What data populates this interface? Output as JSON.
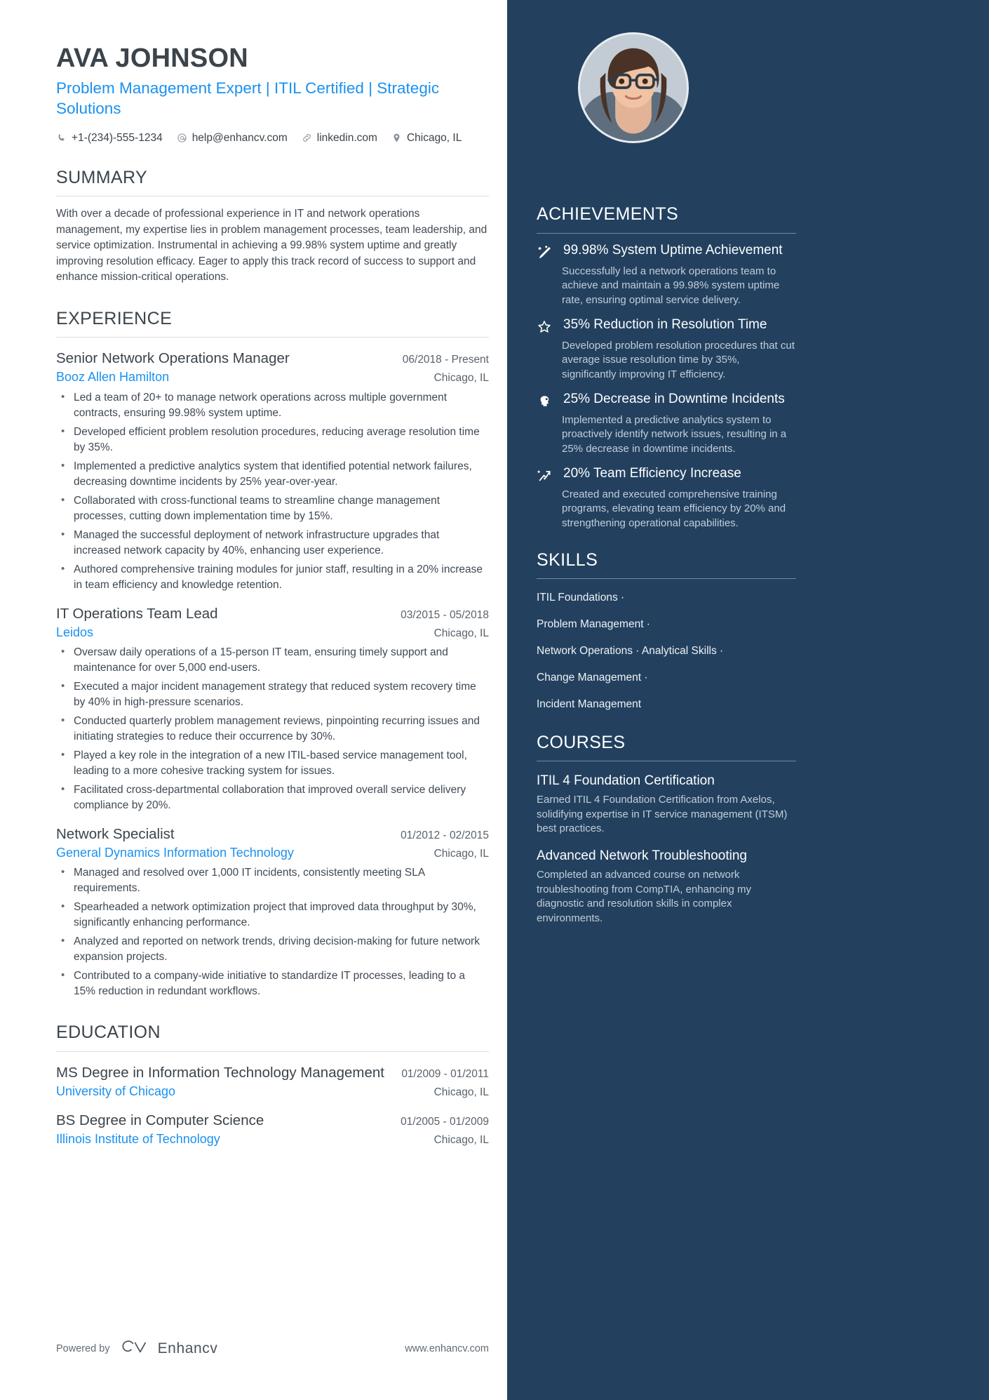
{
  "header": {
    "name": "AVA JOHNSON",
    "headline": "Problem Management Expert | ITIL Certified | Strategic Solutions",
    "contacts": [
      {
        "icon": "phone-icon",
        "text": "+1-(234)-555-1234"
      },
      {
        "icon": "email-icon",
        "text": "help@enhancv.com"
      },
      {
        "icon": "link-icon",
        "text": "linkedin.com"
      },
      {
        "icon": "location-pin-icon",
        "text": "Chicago, IL"
      }
    ]
  },
  "summary": {
    "title": "SUMMARY",
    "text": "With over a decade of professional experience in IT and network operations management, my expertise lies in problem management processes, team leadership, and service optimization. Instrumental in achieving a 99.98% system uptime and greatly improving resolution efficacy. Eager to apply this track record of success to support and enhance mission-critical operations."
  },
  "experience": {
    "title": "EXPERIENCE",
    "entries": [
      {
        "role": "Senior Network Operations Manager",
        "date": "06/2018 - Present",
        "company": "Booz Allen Hamilton",
        "location": "Chicago, IL",
        "bullets": [
          "Led a team of 20+ to manage network operations across multiple government contracts, ensuring 99.98% system uptime.",
          "Developed efficient problem resolution procedures, reducing average resolution time by 35%.",
          "Implemented a predictive analytics system that identified potential network failures, decreasing downtime incidents by 25% year-over-year.",
          "Collaborated with cross-functional teams to streamline change management processes, cutting down implementation time by 15%.",
          "Managed the successful deployment of network infrastructure upgrades that increased network capacity by 40%, enhancing user experience.",
          "Authored comprehensive training modules for junior staff, resulting in a 20% increase in team efficiency and knowledge retention."
        ]
      },
      {
        "role": "IT Operations Team Lead",
        "date": "03/2015 - 05/2018",
        "company": "Leidos",
        "location": "Chicago, IL",
        "bullets": [
          "Oversaw daily operations of a 15-person IT team, ensuring timely support and maintenance for over 5,000 end-users.",
          "Executed a major incident management strategy that reduced system recovery time by 40% in high-pressure scenarios.",
          "Conducted quarterly problem management reviews, pinpointing recurring issues and initiating strategies to reduce their occurrence by 30%.",
          "Played a key role in the integration of a new ITIL-based service management tool, leading to a more cohesive tracking system for issues.",
          "Facilitated cross-departmental collaboration that improved overall service delivery compliance by 20%."
        ]
      },
      {
        "role": "Network Specialist",
        "date": "01/2012 - 02/2015",
        "company": "General Dynamics Information Technology",
        "location": "Chicago, IL",
        "bullets": [
          "Managed and resolved over 1,000 IT incidents, consistently meeting SLA requirements.",
          "Spearheaded a network optimization project that improved data throughput by 30%, significantly enhancing performance.",
          "Analyzed and reported on network trends, driving decision-making for future network expansion projects.",
          "Contributed to a company-wide initiative to standardize IT processes, leading to a 15% reduction in redundant workflows."
        ]
      }
    ]
  },
  "education": {
    "title": "EDUCATION",
    "entries": [
      {
        "degree": "MS Degree in Information Technology Management",
        "date": "01/2009 - 01/2011",
        "school": "University of Chicago",
        "location": "Chicago, IL"
      },
      {
        "degree": "BS Degree in Computer Science",
        "date": "01/2005 - 01/2009",
        "school": "Illinois Institute of Technology",
        "location": "Chicago, IL"
      }
    ]
  },
  "achievements": {
    "title": "ACHIEVEMENTS",
    "items": [
      {
        "icon": "magic-wand-icon",
        "title": "99.98% System Uptime Achievement",
        "desc": "Successfully led a network operations team to achieve and maintain a 99.98% system uptime rate, ensuring optimal service delivery."
      },
      {
        "icon": "star-icon",
        "title": "35% Reduction in Resolution Time",
        "desc": "Developed problem resolution procedures that cut average issue resolution time by 35%, significantly improving IT efficiency."
      },
      {
        "icon": "head-profile-icon",
        "title": "25% Decrease in Downtime Incidents",
        "desc": "Implemented a predictive analytics system to proactively identify network issues, resulting in a 25% decrease in downtime incidents."
      },
      {
        "icon": "growth-arrow-icon",
        "title": "20% Team Efficiency Increase",
        "desc": "Created and executed comprehensive training programs, elevating team efficiency by 20% and strengthening operational capabilities."
      }
    ]
  },
  "skills": {
    "title": "SKILLS",
    "lines": [
      "ITIL Foundations ·",
      "Problem Management ·",
      "Network Operations · Analytical Skills ·",
      "Change Management ·",
      "Incident Management"
    ]
  },
  "courses": {
    "title": "COURSES",
    "items": [
      {
        "title": "ITIL 4 Foundation Certification",
        "desc": "Earned ITIL 4 Foundation Certification from Axelos, solidifying expertise in IT service management (ITSM) best practices."
      },
      {
        "title": "Advanced Network Troubleshooting",
        "desc": "Completed an advanced course on network troubleshooting from CompTIA, enhancing my diagnostic and resolution skills in complex environments."
      }
    ]
  },
  "footer": {
    "powered_by": "Powered by",
    "brand": "Enhancv",
    "url": "www.enhancv.com"
  },
  "colors": {
    "sidebar_bg": "#23415f",
    "accent_blue": "#1a91f0",
    "heading": "#3b444b",
    "body": "#3f4954"
  }
}
